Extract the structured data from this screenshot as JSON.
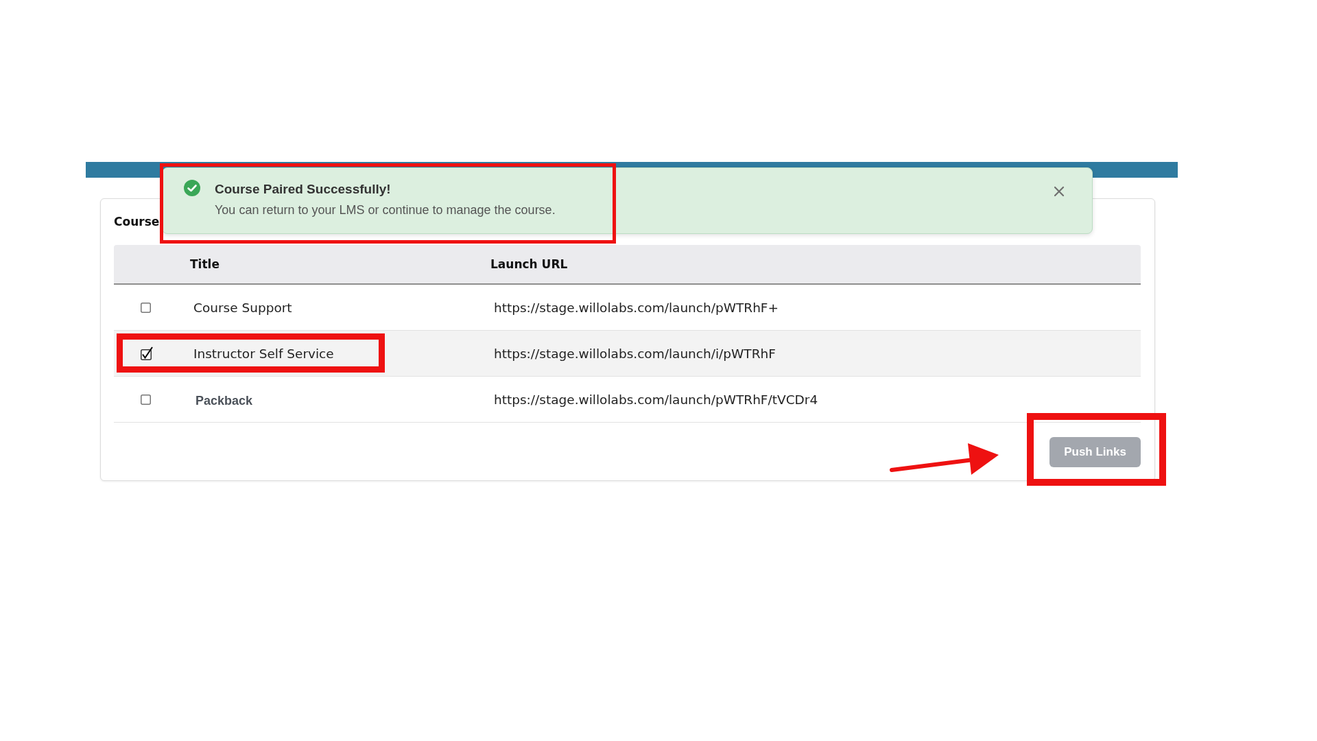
{
  "toast": {
    "kind": "success",
    "title": "Course Paired Successfully!",
    "message": "You can return to your LMS or continue to manage the course.",
    "highlighted": true
  },
  "card": {
    "heading": "Course",
    "table": {
      "columns": [
        "Title",
        "Launch URL"
      ],
      "rows": [
        {
          "kind": "plain",
          "checked": false,
          "title": "Course Support",
          "url": "https://stage.willolabs.com/launch/pWTRhF+",
          "highlighted": false
        },
        {
          "kind": "plain",
          "checked": true,
          "title": "Instructor Self Service",
          "url": "https://stage.willolabs.com/launch/i/pWTRhF",
          "highlighted": true
        },
        {
          "kind": "bold",
          "checked": false,
          "title": "Packback",
          "url": "https://stage.willolabs.com/launch/pWTRhF/tVCDr4",
          "highlighted": false
        }
      ]
    },
    "push_button": {
      "label": "Push Links",
      "disabled": true,
      "highlighted": true,
      "pointed_at": true
    }
  }
}
